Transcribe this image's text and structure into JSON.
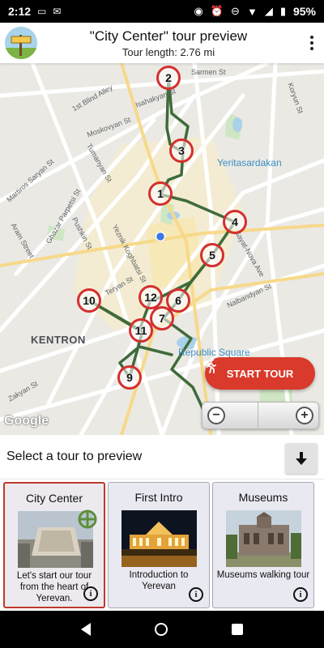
{
  "status_bar": {
    "time": "2:12",
    "battery": "95%",
    "icons_left": [
      "sim-card-icon",
      "message-icon"
    ],
    "icons_right": [
      "location-icon",
      "alarm-icon",
      "do-not-disturb-icon",
      "wifi-icon",
      "signal-icon",
      "battery-icon"
    ]
  },
  "app_bar": {
    "title": "\"City Center\" tour preview",
    "subtitle": "Tour length: 2.76 mi"
  },
  "map": {
    "labels": {
      "sarmen": "Sarmen St",
      "blind_alley": "1st Blind Alley",
      "isahakyan": "Isahakyan St",
      "koryun": "Koryun St",
      "moskovyan": "Moskovyan St",
      "martiros": "Martiros Saryan St",
      "tumanyan": "Tumanyan St",
      "yeritasardakan": "Yeritasardakan",
      "ghazar": "Ghazar Parpetsi St",
      "arami": "Aram Street",
      "pushkin": "Pushkin St",
      "yeznik": "Yeznik Koghbatsi St",
      "sayat_nova": "Sayat-Nova Ave",
      "teryan": "Teryan St",
      "nalbandyan": "Nalbandyan St",
      "kentron": "KENTRON",
      "republic_square": "Republic Square",
      "zakyan": "Zakyan St",
      "google": "Google"
    },
    "tour_stops": [
      "1",
      "2",
      "3",
      "4",
      "5",
      "6",
      "7",
      "9",
      "10",
      "11",
      "12"
    ],
    "start_button": "START TOUR"
  },
  "tour_selector": {
    "label": "Select a tour to preview",
    "cards": [
      {
        "title": "City Center",
        "description": "Let's start our tour from the heart of Yerevan.",
        "selected": true
      },
      {
        "title": "First Intro",
        "description": "Introduction to Yerevan",
        "selected": false
      },
      {
        "title": "Museums",
        "description": "Museums walking tour",
        "selected": false
      }
    ]
  },
  "colors": {
    "accent_red": "#d93a2b",
    "route_green": "#3f6b3a",
    "selected_border": "#c0392b"
  }
}
